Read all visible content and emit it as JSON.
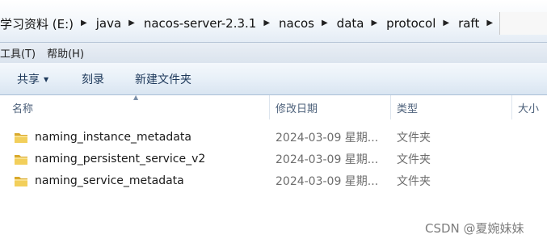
{
  "address_bar": {
    "crumbs": [
      "学习资料 (E:)",
      "java",
      "nacos-server-2.3.1",
      "nacos",
      "data",
      "protocol",
      "raft"
    ]
  },
  "menu": {
    "items": [
      "工具(T)",
      "帮助(H)"
    ]
  },
  "toolbar": {
    "share_label": "共享",
    "burn_label": "刻录",
    "new_folder_label": "新建文件夹"
  },
  "columns": {
    "name": "名称",
    "date_modified": "修改日期",
    "type": "类型",
    "size": "大小"
  },
  "files": [
    {
      "name": "naming_instance_metadata",
      "date": "2024-03-09 星期...",
      "type": "文件夹",
      "icon": "folder-icon"
    },
    {
      "name": "naming_persistent_service_v2",
      "date": "2024-03-09 星期...",
      "type": "文件夹",
      "icon": "folder-icon"
    },
    {
      "name": "naming_service_metadata",
      "date": "2024-03-09 星期...",
      "type": "文件夹",
      "icon": "folder-icon"
    }
  ],
  "watermark": "CSDN @夏婉妹妹",
  "colors": {
    "folder_yellow": "#f2cf5b",
    "toolbar_text": "#1e395b",
    "header_text": "#4c607a",
    "secondary_text": "#6d6d6d"
  }
}
